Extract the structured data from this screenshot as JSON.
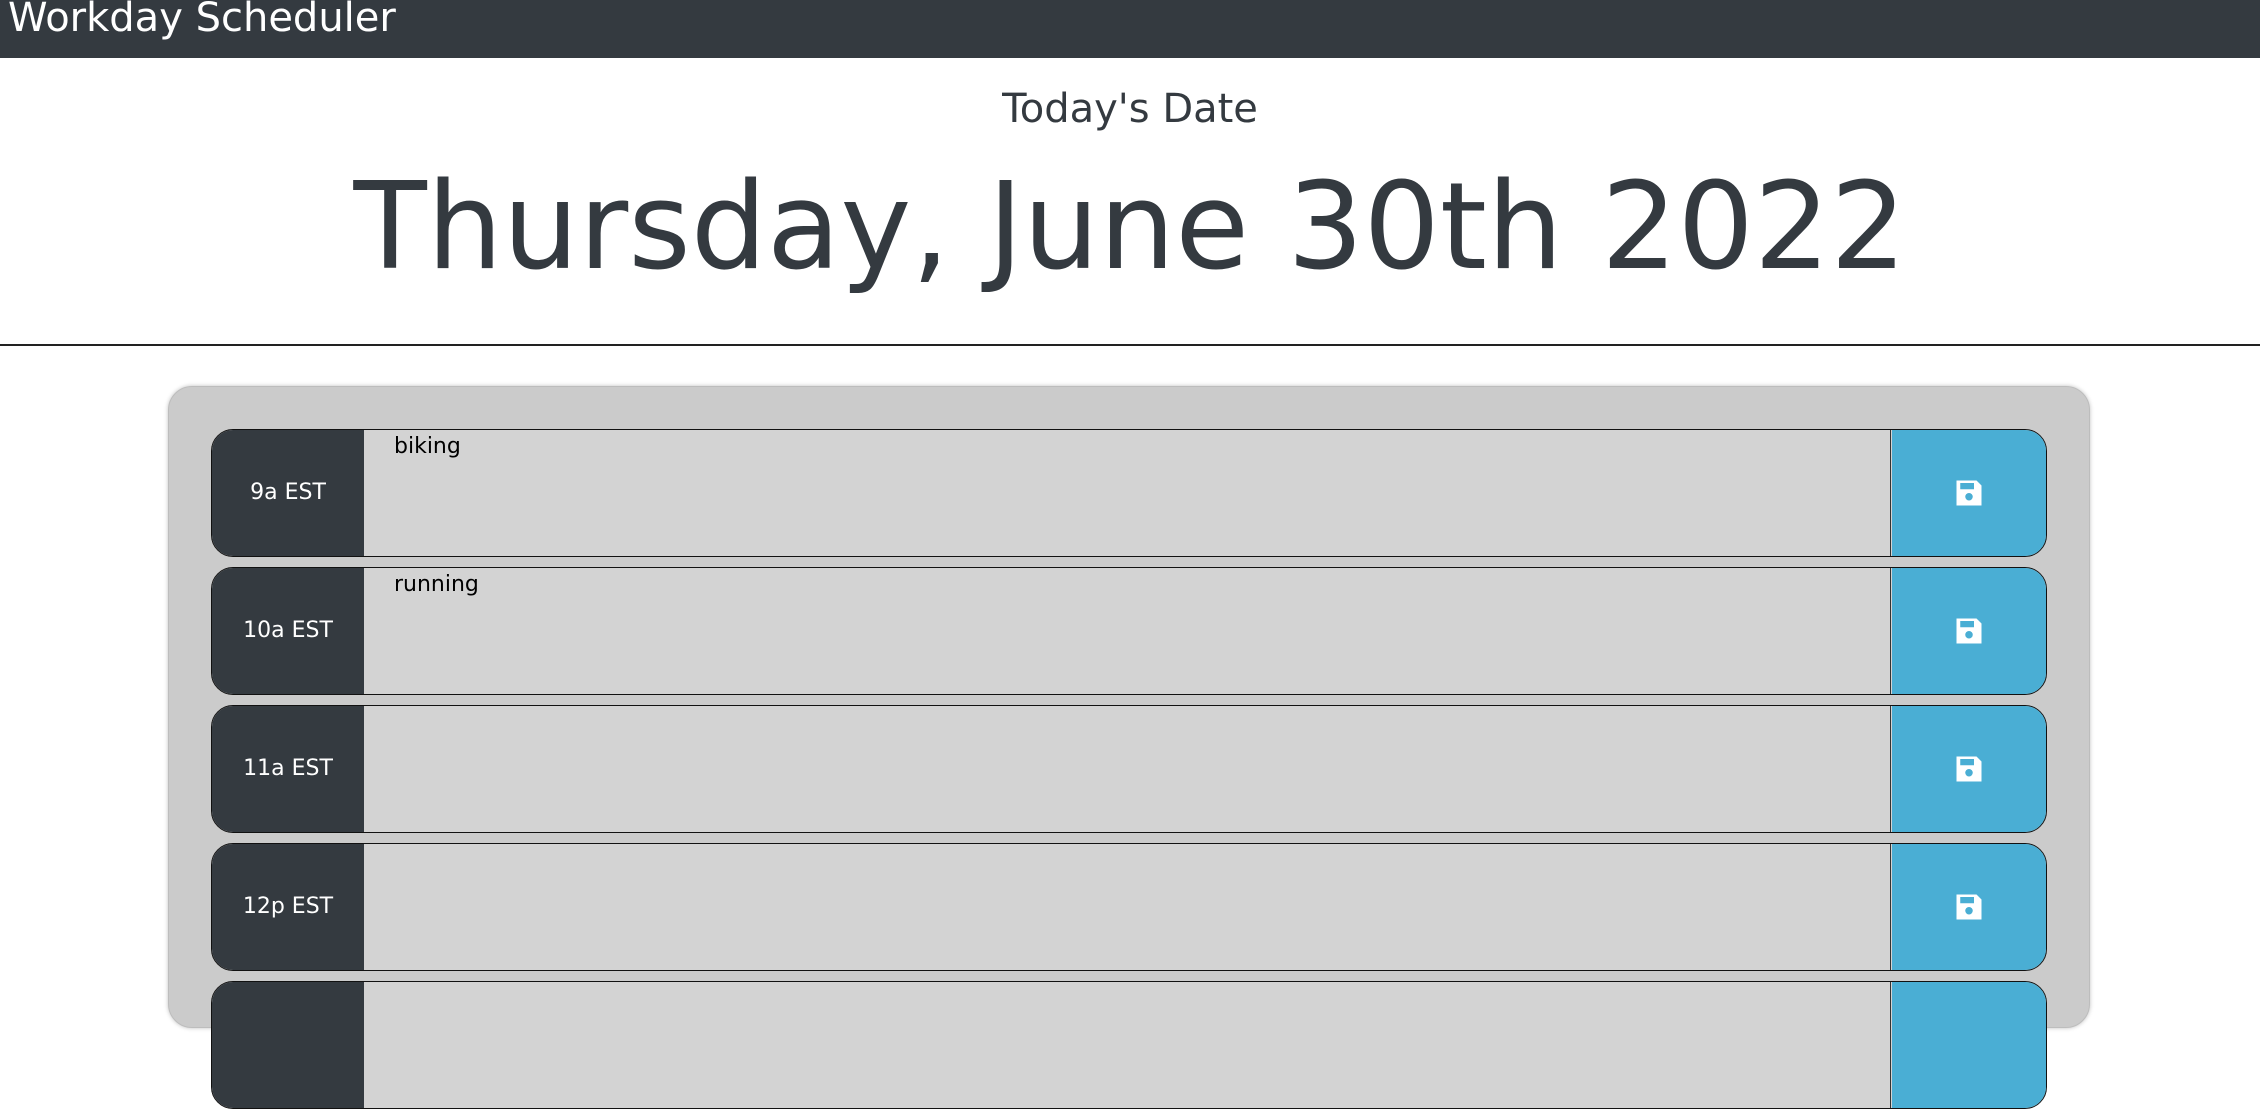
{
  "navbar": {
    "brand": "Workday Scheduler"
  },
  "header": {
    "subtitle": "Today's Date",
    "date": "Thursday, June 30th 2022"
  },
  "rows": [
    {
      "hour": "9a EST",
      "text": "biking",
      "save_icon": "save-icon"
    },
    {
      "hour": "10a EST",
      "text": "running",
      "save_icon": "save-icon"
    },
    {
      "hour": "11a EST",
      "text": "",
      "save_icon": "save-icon"
    },
    {
      "hour": "12p EST",
      "text": "",
      "save_icon": "save-icon"
    }
  ],
  "colors": {
    "navbar": "#343a40",
    "hour_block": "#343a40",
    "row_background": "#d3d3d3",
    "save_button": "#4aaed4",
    "container": "#cbcbcb"
  }
}
